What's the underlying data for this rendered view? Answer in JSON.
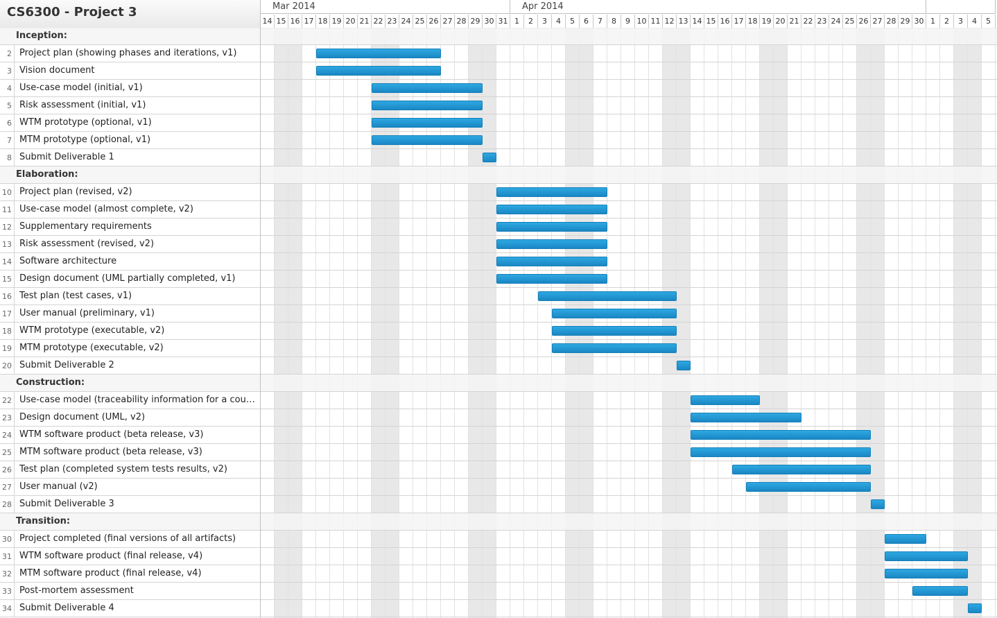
{
  "title": "CS6300 - Project 3",
  "timeline": {
    "months": [
      {
        "label": "Mar 2014",
        "start": 0,
        "count": 18
      },
      {
        "label": "Apr 2014",
        "start": 18,
        "count": 30
      },
      {
        "label": "",
        "start": 48,
        "count": 5
      }
    ],
    "days": [
      "14",
      "15",
      "16",
      "17",
      "18",
      "19",
      "20",
      "21",
      "22",
      "23",
      "24",
      "25",
      "26",
      "27",
      "28",
      "29",
      "30",
      "31",
      "1",
      "2",
      "3",
      "4",
      "5",
      "6",
      "7",
      "8",
      "9",
      "10",
      "11",
      "12",
      "13",
      "14",
      "15",
      "16",
      "17",
      "18",
      "19",
      "20",
      "21",
      "22",
      "23",
      "24",
      "25",
      "26",
      "27",
      "28",
      "29",
      "30",
      "1",
      "2",
      "3",
      "4",
      "5"
    ],
    "weekends": [
      1,
      8,
      15,
      22,
      29,
      36,
      43,
      50
    ],
    "bar_color": "#1a8fd0"
  },
  "rows": [
    {
      "type": "phase",
      "label": "Inception:"
    },
    {
      "type": "task",
      "num": "2",
      "label": "Project plan (showing phases and iterations, v1)",
      "start": 4,
      "dur": 9
    },
    {
      "type": "task",
      "num": "3",
      "label": "Vision document",
      "start": 4,
      "dur": 9
    },
    {
      "type": "task",
      "num": "4",
      "label": "Use-case model (initial, v1)",
      "start": 8,
      "dur": 8
    },
    {
      "type": "task",
      "num": "5",
      "label": "Risk assessment (initial, v1)",
      "start": 8,
      "dur": 8
    },
    {
      "type": "task",
      "num": "6",
      "label": "WTM prototype (optional, v1)",
      "start": 8,
      "dur": 8
    },
    {
      "type": "task",
      "num": "7",
      "label": "MTM prototype (optional, v1)",
      "start": 8,
      "dur": 8
    },
    {
      "type": "task",
      "num": "8",
      "label": "Submit Deliverable 1",
      "start": 16,
      "dur": 1
    },
    {
      "type": "phase",
      "label": "Elaboration:"
    },
    {
      "type": "task",
      "num": "10",
      "label": "Project plan (revised, v2)",
      "start": 17,
      "dur": 8
    },
    {
      "type": "task",
      "num": "11",
      "label": "Use-case model (almost complete, v2)",
      "start": 17,
      "dur": 8
    },
    {
      "type": "task",
      "num": "12",
      "label": "Supplementary requirements",
      "start": 17,
      "dur": 8
    },
    {
      "type": "task",
      "num": "13",
      "label": "Risk assessment (revised, v2)",
      "start": 17,
      "dur": 8
    },
    {
      "type": "task",
      "num": "14",
      "label": "Software architecture",
      "start": 17,
      "dur": 8
    },
    {
      "type": "task",
      "num": "15",
      "label": "Design document (UML partially completed, v1)",
      "start": 17,
      "dur": 8
    },
    {
      "type": "task",
      "num": "16",
      "label": "Test plan (test cases, v1)",
      "start": 20,
      "dur": 10
    },
    {
      "type": "task",
      "num": "17",
      "label": "User manual (preliminary, v1)",
      "start": 21,
      "dur": 9
    },
    {
      "type": "task",
      "num": "18",
      "label": "WTM prototype (executable, v2)",
      "start": 21,
      "dur": 9
    },
    {
      "type": "task",
      "num": "19",
      "label": "MTM prototype (executable, v2)",
      "start": 21,
      "dur": 9
    },
    {
      "type": "task",
      "num": "20",
      "label": "Submit Deliverable 2",
      "start": 30,
      "dur": 1
    },
    {
      "type": "phase",
      "label": "Construction:"
    },
    {
      "type": "task",
      "num": "22",
      "label": "Use-case model (traceability information for a couple…",
      "start": 31,
      "dur": 5
    },
    {
      "type": "task",
      "num": "23",
      "label": "Design document (UML, v2)",
      "start": 31,
      "dur": 8
    },
    {
      "type": "task",
      "num": "24",
      "label": "WTM software product (beta release, v3)",
      "start": 31,
      "dur": 13
    },
    {
      "type": "task",
      "num": "25",
      "label": "MTM software product (beta release, v3)",
      "start": 31,
      "dur": 13
    },
    {
      "type": "task",
      "num": "26",
      "label": "Test plan (completed system tests results, v2)",
      "start": 34,
      "dur": 10
    },
    {
      "type": "task",
      "num": "27",
      "label": "User manual (v2)",
      "start": 35,
      "dur": 9
    },
    {
      "type": "task",
      "num": "28",
      "label": "Submit Deliverable 3",
      "start": 44,
      "dur": 1
    },
    {
      "type": "phase",
      "label": "Transition:"
    },
    {
      "type": "task",
      "num": "30",
      "label": "Project completed (final versions of all artifacts)",
      "start": 45,
      "dur": 3
    },
    {
      "type": "task",
      "num": "31",
      "label": "WTM software product (final release, v4)",
      "start": 45,
      "dur": 6
    },
    {
      "type": "task",
      "num": "32",
      "label": "MTM software product (final release, v4)",
      "start": 45,
      "dur": 6
    },
    {
      "type": "task",
      "num": "33",
      "label": "Post-mortem assessment",
      "start": 47,
      "dur": 4
    },
    {
      "type": "task",
      "num": "34",
      "label": "Submit Deliverable 4",
      "start": 51,
      "dur": 1
    }
  ]
}
